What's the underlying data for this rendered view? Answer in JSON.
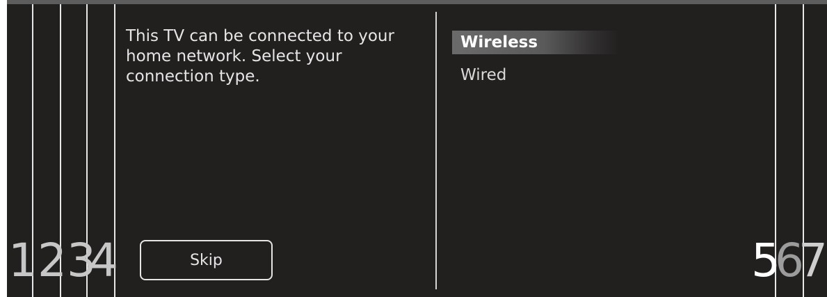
{
  "intro_text": "This TV can be connected to your home network. Select your connection type.",
  "skip_label": "Skip",
  "options": [
    {
      "label": "Wireless",
      "selected": true
    },
    {
      "label": "Wired",
      "selected": false
    }
  ],
  "callouts": {
    "left": [
      "1",
      "2",
      "3",
      "4"
    ],
    "right": [
      "5",
      "6",
      "7"
    ]
  },
  "colors": {
    "background": "#221f1f",
    "text": "#e6e6e6",
    "highlight": "#6b6b6b"
  }
}
